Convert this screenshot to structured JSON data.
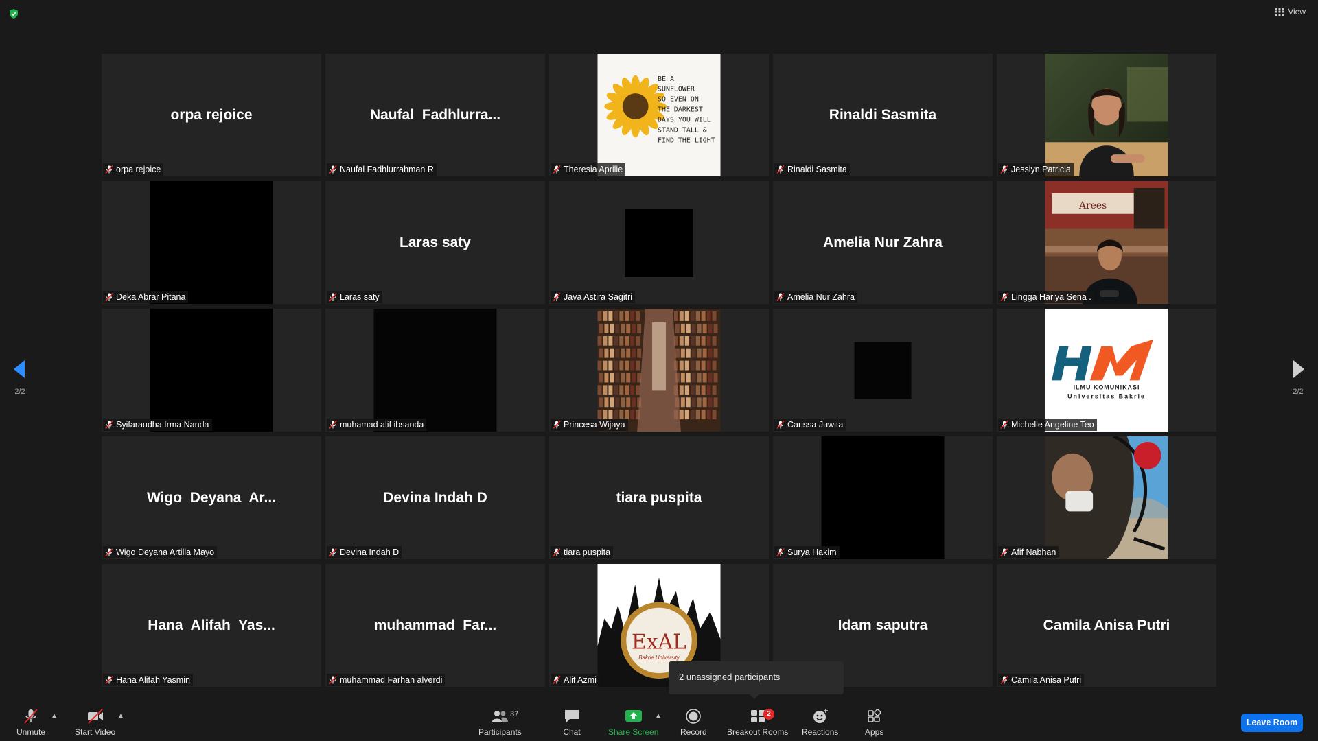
{
  "top": {
    "view_label": "View"
  },
  "pagination": {
    "left": "2/2",
    "right": "2/2"
  },
  "tiles": [
    {
      "big": "orpa rejoice",
      "label": "orpa rejoice",
      "video": ""
    },
    {
      "big": "Naufal  Fadhlurra...",
      "label": "Naufal Fadhlurrahman R",
      "video": ""
    },
    {
      "big": "",
      "label": "Theresia Aprilie",
      "video": "sunflower"
    },
    {
      "big": "Rinaldi Sasmita",
      "label": "Rinaldi Sasmita",
      "video": ""
    },
    {
      "big": "",
      "label": "Jesslyn Patricia",
      "video": "girl"
    },
    {
      "big": "",
      "label": "Deka Abrar Pitana",
      "video": "black"
    },
    {
      "big": "Laras saty",
      "label": "Laras saty",
      "video": ""
    },
    {
      "big": "",
      "label": "Java Astira Sagitri",
      "video": "blacksmall"
    },
    {
      "big": "Amelia Nur Zahra",
      "label": "Amelia Nur Zahra",
      "video": ""
    },
    {
      "big": "",
      "label": "Lingga Hariya Sena .",
      "video": "cafe"
    },
    {
      "big": "",
      "label": "Syifaraudha Irma Nanda",
      "video": "black"
    },
    {
      "big": "",
      "label": "muhamad alif ibsanda",
      "video": "dark"
    },
    {
      "big": "",
      "label": "Princesa Wijaya",
      "video": "library"
    },
    {
      "big": "",
      "label": "Carissa Juwita",
      "video": "blacktiny"
    },
    {
      "big": "",
      "label": "Michelle Angeline Teo",
      "video": "logo"
    },
    {
      "big": "Wigo  Deyana  Ar...",
      "label": "Wigo Deyana Artilla Mayo",
      "video": ""
    },
    {
      "big": "Devina Indah D",
      "label": "Devina Indah D",
      "video": ""
    },
    {
      "big": "tiara puspita",
      "label": "tiara puspita",
      "video": ""
    },
    {
      "big": "",
      "label": "Surya Hakim",
      "video": "black"
    },
    {
      "big": "",
      "label": "Afif Nabhan",
      "video": "mirror"
    },
    {
      "big": "Hana  Alifah  Yas...",
      "label": "Hana Alifah Yasmin",
      "video": ""
    },
    {
      "big": "muhammad  Far...",
      "label": "muhammad Farhan alverdi",
      "video": ""
    },
    {
      "big": "",
      "label": "Alif Azmi",
      "video": "exal"
    },
    {
      "big": "Idam saputra",
      "label": "",
      "video": ""
    },
    {
      "big": "Camila Anisa Putri",
      "label": "Camila Anisa Putri",
      "video": ""
    }
  ],
  "video_text": {
    "sunflower": [
      "BE A",
      "SUNFLOWER",
      "SO EVEN ON",
      "THE DARKEST",
      "DAYS YOU WILL",
      "STAND TALL &",
      "FIND THE LIGHT"
    ],
    "logo_line1": "ILMU KOMUNIKASI",
    "logo_line2": "Universitas Bakrie",
    "exal_title": "ExAL",
    "exal_sub": "Bakrie University"
  },
  "tooltip": {
    "text": "2 unassigned participants"
  },
  "toolbar": {
    "unmute": "Unmute",
    "start_video": "Start Video",
    "participants": "Participants",
    "participants_count": "37",
    "chat": "Chat",
    "share_screen": "Share Screen",
    "record": "Record",
    "breakout_rooms": "Breakout Rooms",
    "breakout_badge": "2",
    "reactions": "Reactions",
    "apps": "Apps",
    "leave": "Leave Room"
  },
  "colors": {
    "accent_blue": "#0e72ed",
    "share_green": "#23b14d",
    "mute_red": "#e02828",
    "arrow_blue": "#2d8cff"
  }
}
